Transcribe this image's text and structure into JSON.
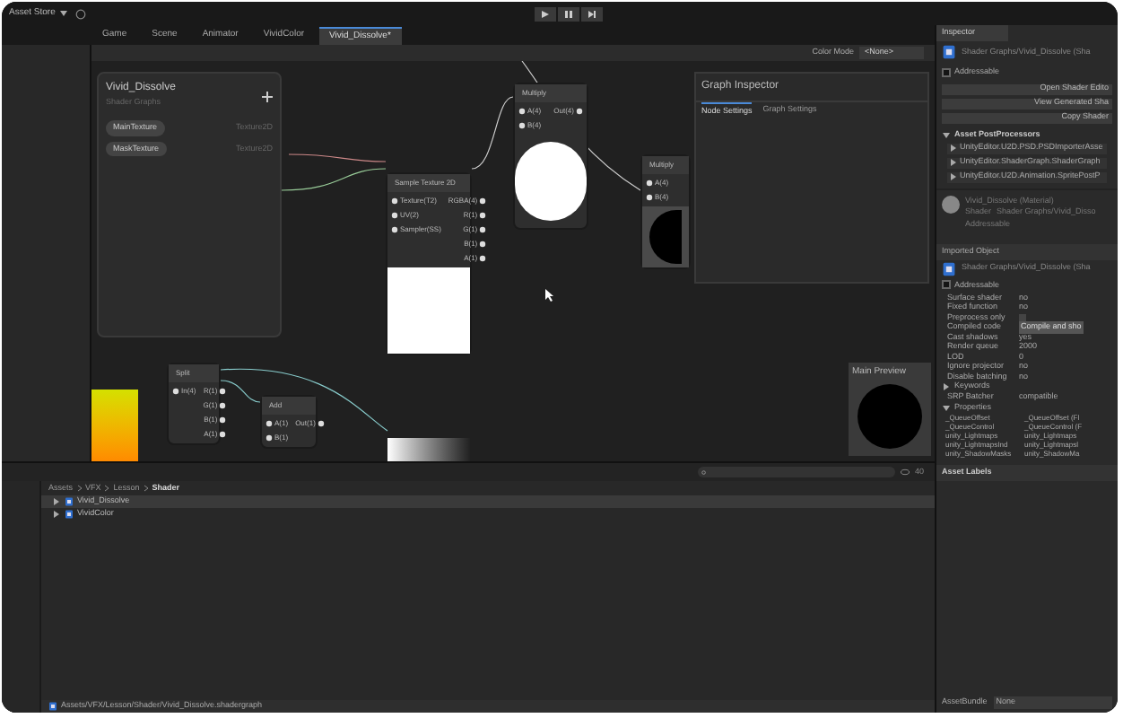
{
  "top_bar": {
    "asset_store": "Asset Store"
  },
  "tabs": [
    {
      "label": "Game",
      "selected": false
    },
    {
      "label": "Scene",
      "selected": false
    },
    {
      "label": "Animator",
      "selected": false
    },
    {
      "label": "VividColor",
      "selected": false
    },
    {
      "label": "Vivid_Dissolve*",
      "selected": true
    }
  ],
  "graph_toolbar": {
    "color_mode_label": "Color Mode",
    "color_mode_value": "<None>"
  },
  "blackboard": {
    "title": "Vivid_Dissolve",
    "subtitle": "Shader Graphs",
    "properties": [
      {
        "name": "MainTexture",
        "type": "Texture2D"
      },
      {
        "name": "MaskTexture",
        "type": "Texture2D"
      }
    ]
  },
  "nodes": [
    {
      "title": "Sample Texture 2D",
      "inputs": [
        "Texture(T2)",
        "UV(2)",
        "Sampler(SS)"
      ],
      "outputs": [
        "RGBA(4)",
        "R(1)",
        "G(1)",
        "B(1)",
        "A(1)"
      ],
      "kind": "texture"
    },
    {
      "title": "Multiply",
      "inputs": [
        "A(4)",
        "B(4)"
      ],
      "outputs": [
        "Out(4)"
      ],
      "kind": "disc"
    },
    {
      "title": "Multiply",
      "inputs": [
        "A(4)",
        "B(4)"
      ],
      "kind": "sphere"
    },
    {
      "title": "Split",
      "inputs": [
        "In(4)"
      ],
      "outputs": [
        "R(1)",
        "G(1)",
        "B(1)",
        "A(1)"
      ],
      "kind": "plain"
    },
    {
      "title": "Add",
      "inputs": [
        "A(1)",
        "B(1)"
      ],
      "outputs": [
        "Out(1)"
      ],
      "kind": "plain"
    }
  ],
  "graph_inspector": {
    "title": "Graph Inspector",
    "tabs": [
      {
        "label": "Node Settings",
        "selected": true
      },
      {
        "label": "Graph Settings",
        "selected": false
      }
    ]
  },
  "main_preview": {
    "title": "Main Preview"
  },
  "project": {
    "breadcrumb": [
      "Assets",
      "VFX",
      "Lesson",
      "Shader"
    ],
    "items": [
      {
        "name": "Vivid_Dissolve",
        "selected": true
      },
      {
        "name": "VividColor",
        "selected": false
      }
    ],
    "path": "Assets/VFX/Lesson/Shader/Vivid_Dissolve.shadergraph",
    "count": "40"
  },
  "inspector": {
    "tab": "Inspector",
    "asset_title": "Shader Graphs/Vivid_Dissolve (Sha",
    "addressable": {
      "label": "Addressable",
      "checked": false
    },
    "buttons": [
      "Open Shader Edito",
      "View Generated Sha",
      "Copy Shader"
    ],
    "postprocessors": {
      "title": "Asset PostProcessors",
      "expanded": true,
      "items": [
        "UnityEditor.U2D.PSD.PSDImporterAsse",
        "UnityEditor.ShaderGraph.ShaderGraph",
        "UnityEditor.U2D.Animation.SpritePostP"
      ]
    },
    "material": {
      "name": "Vivid_Dissolve (Material)",
      "shader_label": "Shader",
      "shader_value": "Shader Graphs/Vivid_Disso",
      "addressable": "Addressable"
    },
    "imported_object": "Imported Object",
    "imported_title": "Shader Graphs/Vivid_Dissolve (Sha",
    "imported_addressable": {
      "label": "Addressable",
      "checked": false
    },
    "props": [
      {
        "label": "Surface shader",
        "value": "no",
        "kind": "text"
      },
      {
        "label": "Fixed function",
        "value": "no",
        "kind": "text"
      },
      {
        "label": "Preprocess only",
        "kind": "checkbox",
        "checked": false
      },
      {
        "label": "Compiled code",
        "value": "Compile and sho",
        "kind": "button"
      },
      {
        "label": "Cast shadows",
        "value": "yes",
        "kind": "text"
      },
      {
        "label": "Render queue",
        "value": "2000",
        "kind": "text"
      },
      {
        "label": "LOD",
        "value": "0",
        "kind": "text"
      },
      {
        "label": "Ignore projector",
        "value": "no",
        "kind": "text"
      },
      {
        "label": "Disable batching",
        "value": "no",
        "kind": "text"
      }
    ],
    "keywords": {
      "title": "Keywords",
      "expanded": false
    },
    "srp_batcher": {
      "label": "SRP Batcher",
      "value": "compatible"
    },
    "properties": {
      "title": "Properties",
      "expanded": true,
      "rows": [
        {
          "label": "_QueueOffset",
          "value": "_QueueOffset (Fl"
        },
        {
          "label": "_QueueControl",
          "value": "_QueueControl (F"
        },
        {
          "label": "unity_Lightmaps",
          "value": "unity_Lightmaps"
        },
        {
          "label": "unity_LightmapsInd",
          "value": "unity_Lightmapsl"
        },
        {
          "label": "unity_ShadowMasks",
          "value": "unity_ShadowMa"
        }
      ]
    },
    "asset_labels": "Asset Labels",
    "asset_bundle": {
      "label": "AssetBundle",
      "value": "None"
    }
  }
}
